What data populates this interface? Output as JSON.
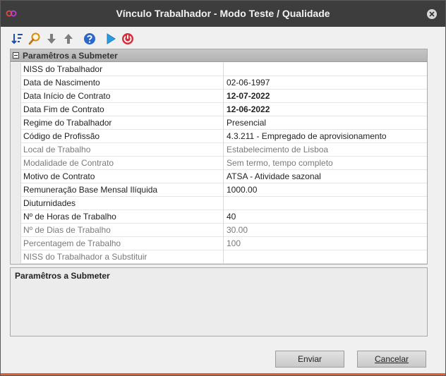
{
  "window": {
    "title": "Vínculo Trabalhador - Modo Teste / Qualidade"
  },
  "toolbar": {
    "buttons": [
      {
        "name": "sort-icon"
      },
      {
        "name": "search-icon"
      },
      {
        "name": "arrow-down-icon"
      },
      {
        "name": "arrow-up-icon"
      },
      {
        "name": "help-icon"
      },
      {
        "name": "play-icon"
      },
      {
        "name": "power-icon"
      }
    ]
  },
  "grid": {
    "section_title": "Paramêtros a Submeter",
    "rows": [
      {
        "label": "NISS do Trabalhador",
        "value": "",
        "bold": false,
        "disabled": false
      },
      {
        "label": "Data de Nascimento",
        "value": "02-06-1997",
        "bold": false,
        "disabled": false
      },
      {
        "label": "Data Início de Contrato",
        "value": "12-07-2022",
        "bold": true,
        "disabled": false
      },
      {
        "label": "Data Fim de Contrato",
        "value": "12-06-2022",
        "bold": true,
        "disabled": false
      },
      {
        "label": "Regime do Trabalhador",
        "value": "Presencial",
        "bold": false,
        "disabled": false
      },
      {
        "label": "Código de Profissão",
        "value": "4.3.211 - Empregado de aprovisionamento",
        "bold": false,
        "disabled": false
      },
      {
        "label": "Local de Trabalho",
        "value": "Estabelecimento de Lisboa",
        "bold": false,
        "disabled": true
      },
      {
        "label": "Modalidade de Contrato",
        "value": "Sem termo, tempo completo",
        "bold": false,
        "disabled": true
      },
      {
        "label": "Motivo de Contrato",
        "value": "ATSA - Atividade sazonal",
        "bold": false,
        "disabled": false
      },
      {
        "label": "Remuneração Base Mensal Ilíquida",
        "value": "1000.00",
        "bold": false,
        "disabled": false
      },
      {
        "label": "Diuturnidades",
        "value": "",
        "bold": false,
        "disabled": false
      },
      {
        "label": "Nº de Horas de Trabalho",
        "value": "40",
        "bold": false,
        "disabled": false
      },
      {
        "label": "Nº de Dias de Trabalho",
        "value": "30.00",
        "bold": false,
        "disabled": true
      },
      {
        "label": "Percentagem de Trabalho",
        "value": "100",
        "bold": false,
        "disabled": true
      },
      {
        "label": "NISS do Trabalhador a Substituir",
        "value": "",
        "bold": false,
        "disabled": true
      }
    ]
  },
  "description": {
    "title": "Paramêtros a Submeter"
  },
  "buttons": {
    "send_label": "Enviar",
    "cancel_label": "Cancelar"
  },
  "colors": {
    "titlebar": "#3d3d3d",
    "accent_bar": "#e25e2a"
  }
}
